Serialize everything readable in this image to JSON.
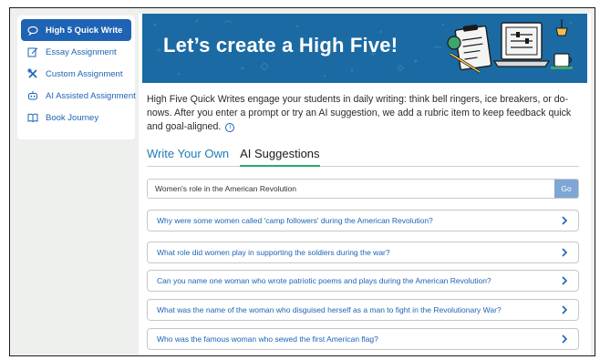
{
  "sidebar": {
    "items": [
      {
        "label": "High 5 Quick Write",
        "icon": "chat-bubbles-icon",
        "active": true
      },
      {
        "label": "Essay Assignment",
        "icon": "edit-icon",
        "active": false
      },
      {
        "label": "Custom Assignment",
        "icon": "tools-icon",
        "active": false
      },
      {
        "label": "AI Assisted Assignment",
        "icon": "robot-icon",
        "active": false
      },
      {
        "label": "Book Journey",
        "icon": "book-icon",
        "active": false
      }
    ]
  },
  "banner": {
    "title": "Let’s create a High Five!"
  },
  "intro": {
    "text": "High Five Quick Writes engage your students in daily writing: think bell ringers, ice breakers, or do-nows. After you enter a prompt or try an AI suggestion, we add a rubric item to keep feedback quick and goal-aligned."
  },
  "tabs": [
    {
      "label": "Write Your Own",
      "active": false
    },
    {
      "label": "AI Suggestions",
      "active": true
    }
  ],
  "search": {
    "value": "Women's role in the American Revolution",
    "button_label": "Go"
  },
  "suggestions": [
    "Why were some women called 'camp followers' during the American Revolution?",
    "What role did women play in supporting the soldiers during the war?",
    "Can you name one woman who wrote patriotic poems and plays during the American Revolution?",
    "What was the name of the woman who disguised herself as a man to fight in the Revolutionary War?",
    "Who was the famous woman who sewed the first American flag?"
  ],
  "colors": {
    "accent": "#1f63b4",
    "banner": "#1b6aa3",
    "tab_underline": "#27a96b",
    "go_button": "#7ea6d6"
  }
}
